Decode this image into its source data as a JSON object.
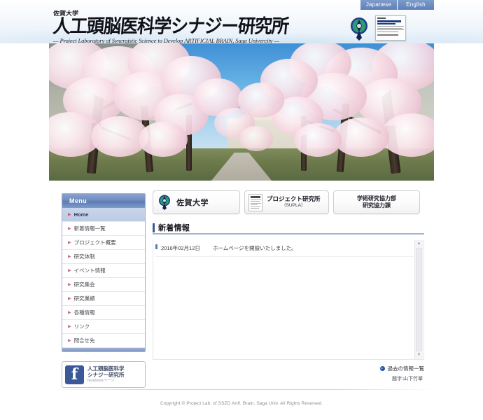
{
  "header": {
    "lang_buttons": [
      {
        "label": "Japanese"
      },
      {
        "label": "English"
      }
    ],
    "university_name": "佐賀大学",
    "site_title": "人工頭脳医科学シナジー研究所",
    "site_subtitle": "— Project Laboratory of Synergistic Science to Develop ARTIFICIAL BRAIN, Saga Univercity —",
    "emblem_icon": "saga-university-emblem-icon",
    "poster_icon": "institute-poster-thumbnail-icon"
  },
  "hero": {
    "alt": "Campus avenue lined with cherry blossom trees in bloom"
  },
  "sidebar": {
    "menu_title": "Menu",
    "items": [
      {
        "label": "Home",
        "active": true
      },
      {
        "label": "新着情報一覧",
        "active": false
      },
      {
        "label": "プロジェクト概要",
        "active": false
      },
      {
        "label": "研究体制",
        "active": false
      },
      {
        "label": "イベント情報",
        "active": false
      },
      {
        "label": "研究集会",
        "active": false
      },
      {
        "label": "研究業績",
        "active": false
      },
      {
        "label": "各種情報",
        "active": false
      },
      {
        "label": "リンク",
        "active": false
      },
      {
        "label": "問合せ先",
        "active": false
      }
    ],
    "facebook_banner": {
      "icon": "facebook-icon",
      "line1": "人工頭脳医科学",
      "line2": "シナジー研究所",
      "line3": "facebookページ"
    }
  },
  "main": {
    "link_boxes": [
      {
        "icon": "saga-university-emblem-icon",
        "label": "佐賀大学",
        "sublabel": ""
      },
      {
        "icon": "document-icon",
        "label": "プロジェクト研究所",
        "sublabel": "（SUPLA）"
      },
      {
        "icon": "",
        "label": "学術研究協力部",
        "sublabel": "研究協力課"
      }
    ],
    "news": {
      "heading": "新着情報",
      "items": [
        {
          "date": "2016年02月12日",
          "text": "ホームページを開設いたしました。"
        }
      ],
      "scrollbar": {
        "up_arrow": "▲",
        "down_arrow": "▼"
      }
    },
    "past_news_link": "過去の情報一覧",
    "credit": "題字:山下竹翠"
  },
  "footer": {
    "copyright": "Copyright © Project Lab. of SSZD Artif. Brain, Saga Univ. All Rights Reserved."
  },
  "colors": {
    "accent_blue": "#5d7cb4",
    "menu_header": "#6f8cc0",
    "facebook_blue": "#3b5998",
    "link_blue": "#2b55a8",
    "arrow_pink": "#c3728d"
  }
}
